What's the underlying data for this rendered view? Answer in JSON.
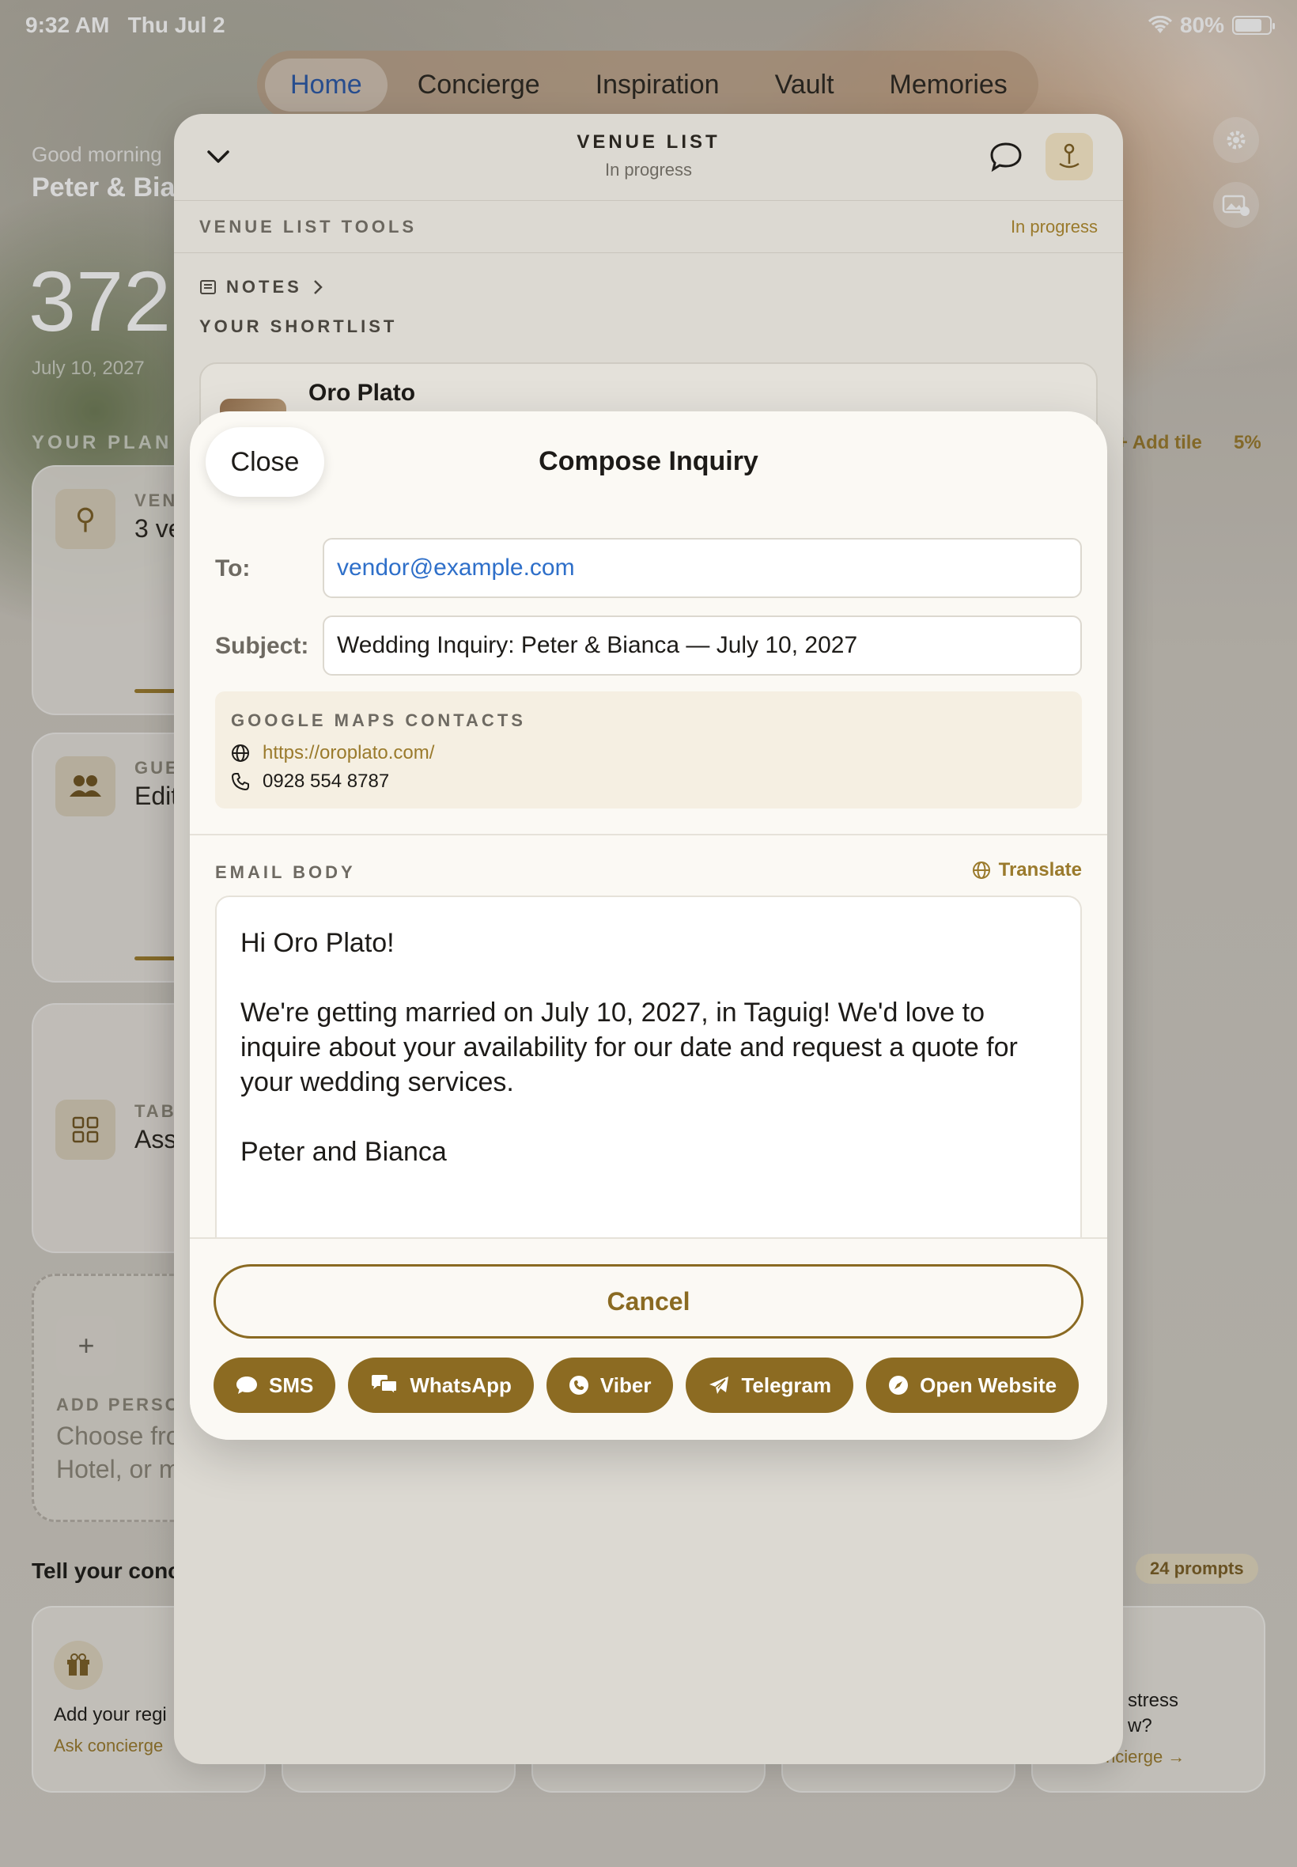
{
  "status_bar": {
    "time": "9:32 AM",
    "date": "Thu Jul 2",
    "battery": "80%"
  },
  "tabs": [
    {
      "label": "Home"
    },
    {
      "label": "Concierge"
    },
    {
      "label": "Inspiration"
    },
    {
      "label": "Vault"
    },
    {
      "label": "Memories"
    }
  ],
  "home": {
    "greeting": "Good morning",
    "names": "Peter & Bia",
    "countdown": "372",
    "date": "July 10, 2027",
    "your_plan_label": "YOUR PLAN",
    "add_tile": "+ Add tile",
    "progress": "5%",
    "cards": [
      {
        "kicker": "VEN",
        "value": "3 ve"
      },
      {
        "kicker": "GUE",
        "value": "Edit"
      },
      {
        "kicker": "TAB",
        "value": "Ass"
      }
    ],
    "add_personal": {
      "kicker": "ADD PERSO",
      "line1": "Choose fro",
      "line2": "Hotel, or m"
    },
    "tell_label": "Tell your conci",
    "prompts_badge": "24 prompts",
    "prompt_first": {
      "title": "Add your regi",
      "link": "Ask concierge"
    },
    "prompt_last": {
      "title": "stress",
      "title2": "w?",
      "link": "Ask concierge →"
    }
  },
  "sheet": {
    "title": "VENUE LIST",
    "subtitle": "In progress",
    "tools_label": "VENUE LIST TOOLS",
    "tools_status": "In progress",
    "notes_label": "NOTES",
    "shortlist_label": "YOUR SHORTLIST",
    "venue_name": "Oro Plato"
  },
  "compose": {
    "close_label": "Close",
    "title": "Compose Inquiry",
    "to_label": "To:",
    "to_value": "vendor@example.com",
    "subject_label": "Subject:",
    "subject_value": "Wedding Inquiry: Peter & Bianca — July 10, 2027",
    "contacts_header": "GOOGLE MAPS CONTACTS",
    "website": "https://oroplato.com/",
    "phone": "0928 554 8787",
    "body_label": "EMAIL BODY",
    "translate_label": "Translate",
    "body_text": "Hi Oro Plato!\n\nWe're getting married on July 10, 2027, in Taguig! We'd love to inquire about your availability for our date and request a quote for your wedding services.\n\nPeter and Bianca",
    "cancel_label": "Cancel",
    "actions": [
      {
        "label": "SMS",
        "icon": "sms-icon"
      },
      {
        "label": "WhatsApp",
        "icon": "whatsapp-icon"
      },
      {
        "label": "Viber",
        "icon": "viber-icon"
      },
      {
        "label": "Telegram",
        "icon": "telegram-icon"
      },
      {
        "label": "Open Website",
        "icon": "compass-icon"
      }
    ]
  },
  "colors": {
    "accent": "#8c6b22",
    "link_blue": "#2e6fc9",
    "sheet_bg": "#fbf9f4"
  }
}
